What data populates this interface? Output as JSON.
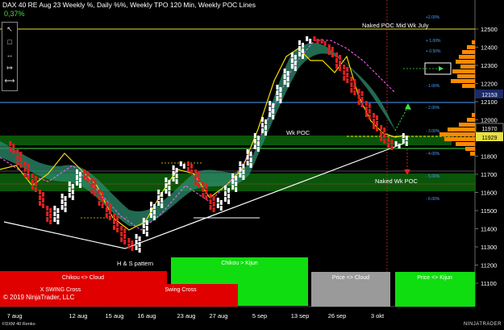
{
  "header": {
    "title": "DAX 40 RE Aug 23 Weekly %, Daily %%, Weekly TPO 120 Min, Weekly POC Lines",
    "change": "0,37%"
  },
  "toolbar": {
    "tools": [
      {
        "icon": "cursor-icon",
        "glyph": "↖"
      },
      {
        "icon": "rectangle-icon",
        "glyph": "□"
      },
      {
        "icon": "horizontal-line-icon",
        "glyph": "↔"
      },
      {
        "icon": "arrow-line-icon",
        "glyph": "↦"
      },
      {
        "icon": "ray-icon",
        "glyph": "⟷"
      },
      {
        "icon": "fib-icon",
        "glyph": "▤"
      }
    ]
  },
  "annotations": {
    "naked_poc_mid_wk_july": "Naked POC Mid Wk July",
    "wk_poc": "Wk POC",
    "naked_wk_poc": "Naked Wk POC",
    "hs_pattern": "H & S pattern"
  },
  "signal_boxes": {
    "chikou_cloud": "Chikou <> Cloud",
    "chikou_kijun": "Chikou > Kijun",
    "x_swing_cross": "X SWING Cross",
    "swing_cross": "Swing Cross",
    "price_cloud": "Price <> Cloud",
    "price_kijun": "Price <> Kijun"
  },
  "price_tags": {
    "t1": "12153",
    "t2": "11970",
    "t3": "11929"
  },
  "percent_levels": {
    "p200": "+2.00%",
    "p100": "+ 1.00%",
    "p050": "+ 0.50%",
    "n100": "- 1.00%",
    "n200": "- 2.00%",
    "n300": "- 3.00%",
    "n400": "- 4.00%",
    "n500": "- 5.00%",
    "n600": "- 6.00%"
  },
  "copyright": "© 2019 NinjaTrader, LLC",
  "footer": {
    "instrument": "FDXM 40 Renko",
    "brand": "NINJATRADER"
  },
  "colors": {
    "up_brick": "#ffffff",
    "down_brick": "#e02020",
    "cloud": "#2e8c6e",
    "tenkan": "#f5e000",
    "kijun": "#ff66ff",
    "poc_band": "#0c6a0c",
    "tpo_profile": "#ff8a00",
    "box_red": "#e00000",
    "box_green": "#10dd10",
    "box_grey": "#9a9a9a"
  },
  "chart_data": {
    "type": "renko",
    "y_ticks": [
      "12500",
      "12400",
      "12300",
      "12200",
      "12100",
      "12000",
      "11900",
      "11800",
      "11700",
      "11600",
      "11500",
      "11400",
      "11300",
      "11200",
      "11100"
    ],
    "x_ticks": [
      "7 aug",
      "12 aug",
      "15 aug",
      "16 aug",
      "23 aug",
      "27 aug",
      "5 sep",
      "13 sep",
      "26 sep",
      "3 okt"
    ],
    "ylim": [
      11020,
      12560
    ]
  }
}
